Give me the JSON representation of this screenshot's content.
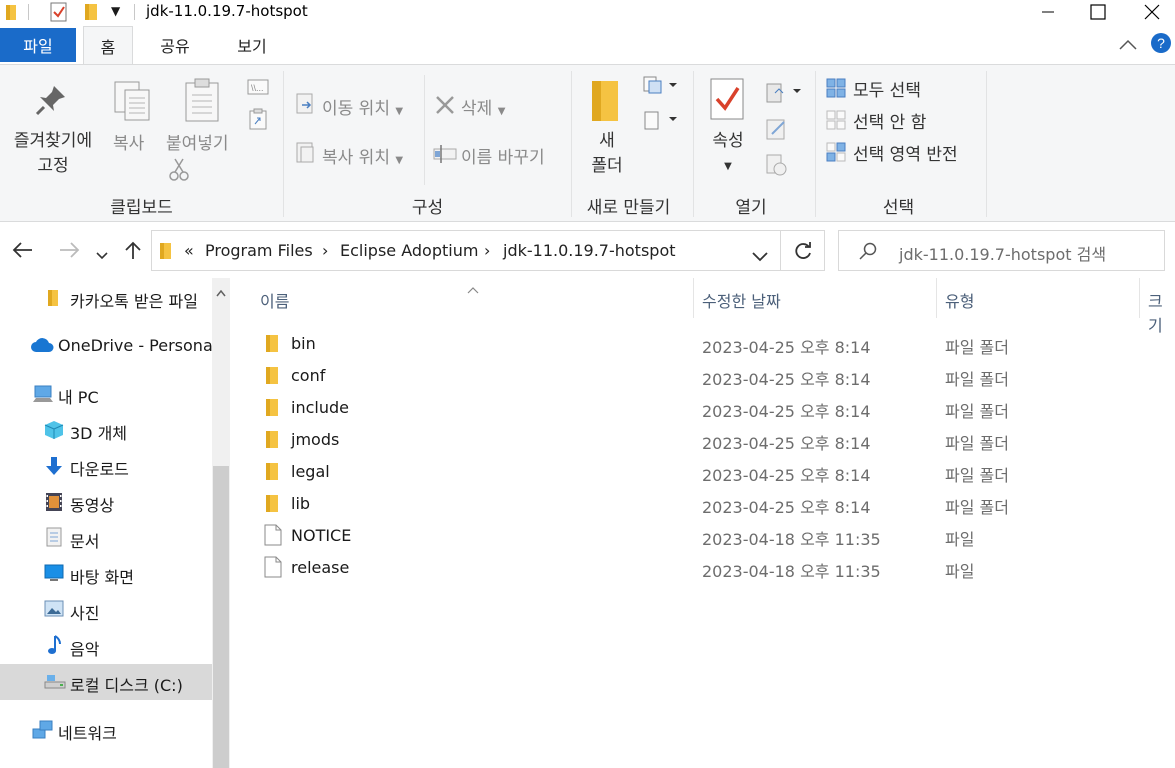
{
  "window": {
    "title": "jdk-11.0.19.7-hotspot"
  },
  "ribbon_tabs": [
    "파일",
    "홈",
    "공유",
    "보기"
  ],
  "ribbon": {
    "clipboard": {
      "pin_line1": "즐겨찾기에",
      "pin_line2": "고정",
      "copy": "복사",
      "paste": "붙여넣기",
      "group": "클립보드"
    },
    "organize": {
      "move_to": "이동 위치",
      "copy_to": "복사 위치",
      "delete": "삭제",
      "rename": "이름 바꾸기",
      "group": "구성"
    },
    "new": {
      "new_folder_line1": "새",
      "new_folder_line2": "폴더",
      "group": "새로 만들기"
    },
    "open": {
      "properties": "속성",
      "group": "열기"
    },
    "select": {
      "select_all": "모두 선택",
      "select_none": "선택 안 함",
      "invert": "선택 영역 반전",
      "group": "선택"
    }
  },
  "address": {
    "overflow": "«",
    "crumbs": [
      "Program Files",
      "Eclipse Adoptium",
      "jdk-11.0.19.7-hotspot"
    ],
    "search_placeholder": "jdk-11.0.19.7-hotspot 검색"
  },
  "nav_pane": {
    "items": [
      {
        "label": "카카오톡 받은 파일",
        "icon": "folder-icon"
      },
      {
        "label": "OneDrive - Personal",
        "icon": "cloud-icon"
      },
      {
        "label": "내 PC",
        "icon": "pc-icon"
      },
      {
        "label": "3D 개체",
        "icon": "cube-icon"
      },
      {
        "label": "다운로드",
        "icon": "download-icon"
      },
      {
        "label": "동영상",
        "icon": "video-icon"
      },
      {
        "label": "문서",
        "icon": "document-icon"
      },
      {
        "label": "바탕 화면",
        "icon": "desktop-icon"
      },
      {
        "label": "사진",
        "icon": "pictures-icon"
      },
      {
        "label": "음악",
        "icon": "music-icon"
      },
      {
        "label": "로컬 디스크 (C:)",
        "icon": "drive-icon"
      },
      {
        "label": "네트워크",
        "icon": "network-icon"
      }
    ]
  },
  "file_list": {
    "columns": [
      "이름",
      "수정한 날짜",
      "유형",
      "크기"
    ],
    "rows": [
      {
        "name": "bin",
        "date": "2023-04-25 오후 8:14",
        "type": "파일 폴더",
        "kind": "folder"
      },
      {
        "name": "conf",
        "date": "2023-04-25 오후 8:14",
        "type": "파일 폴더",
        "kind": "folder"
      },
      {
        "name": "include",
        "date": "2023-04-25 오후 8:14",
        "type": "파일 폴더",
        "kind": "folder"
      },
      {
        "name": "jmods",
        "date": "2023-04-25 오후 8:14",
        "type": "파일 폴더",
        "kind": "folder"
      },
      {
        "name": "legal",
        "date": "2023-04-25 오후 8:14",
        "type": "파일 폴더",
        "kind": "folder"
      },
      {
        "name": "lib",
        "date": "2023-04-25 오후 8:14",
        "type": "파일 폴더",
        "kind": "folder"
      },
      {
        "name": "NOTICE",
        "date": "2023-04-18 오후 11:35",
        "type": "파일",
        "kind": "file"
      },
      {
        "name": "release",
        "date": "2023-04-18 오후 11:35",
        "type": "파일",
        "kind": "file"
      }
    ]
  },
  "colors": {
    "file_tab": "#1a6bc9",
    "folder": "#f5c342",
    "selected_nav": "#d9d9d9"
  }
}
